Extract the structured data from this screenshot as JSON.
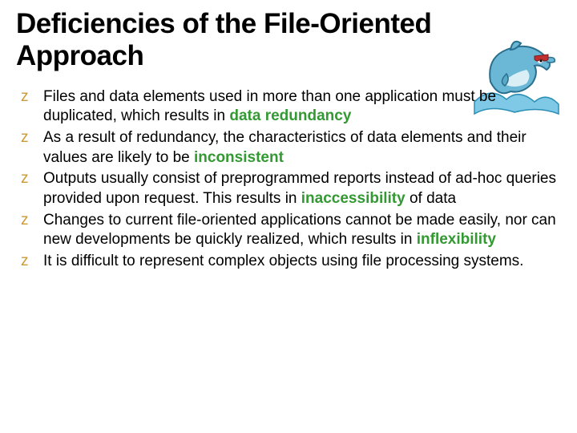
{
  "title": "Deficiencies of the File-Oriented Approach",
  "bullets": [
    {
      "pre": "Files and data elements used in more than one application must be duplicated, which results in ",
      "hl": "data redundancy",
      "post": ""
    },
    {
      "pre": "As a result of redundancy, the characteristics of data elements and their values are likely to be ",
      "hl": "inconsistent",
      "post": ""
    },
    {
      "pre": "Outputs usually consist of preprogrammed reports instead of ad-hoc queries provided upon request.  This results in ",
      "hl": "inaccessibility",
      "post": " of data"
    },
    {
      "pre": "Changes to current file-oriented applications cannot be made easily, nor can new developments be quickly realized, which results in ",
      "hl": "inflexibility",
      "post": ""
    },
    {
      "pre": "It is difficult to represent complex objects using file processing systems.",
      "hl": "",
      "post": ""
    }
  ]
}
